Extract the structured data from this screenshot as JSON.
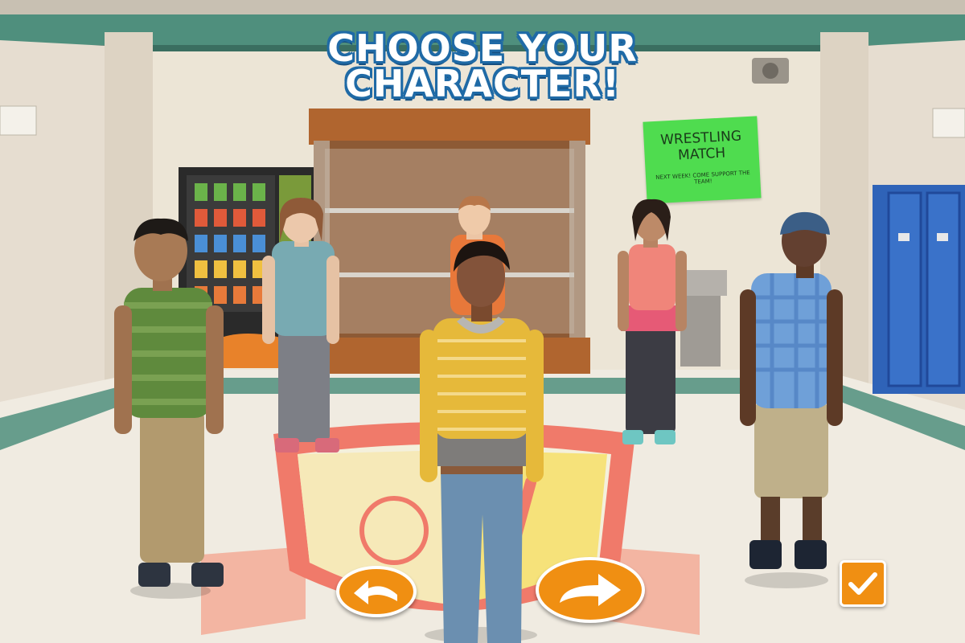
{
  "title": {
    "line1": "CHOOSE YOUR",
    "line2": "CHARACTER!"
  },
  "poster": {
    "line1": "WRESTLING",
    "line2": "MATCH",
    "footer": "NEXT WEEK! COME SUPPORT THE TEAM!"
  },
  "characters": [
    {
      "id": "boy-green-stripes",
      "shirt": "#5f8a3d",
      "pants": "#a08a62"
    },
    {
      "id": "girl-teal-top",
      "shirt": "#78aab2",
      "pants": "#8a8a8a"
    },
    {
      "id": "boy-orange-shirt",
      "shirt": "#e8783a",
      "pants": "#6b4a2a"
    },
    {
      "id": "girl-yellow-stripes",
      "shirt": "#e6b93a",
      "pants": "#6b8fb0",
      "selected": true
    },
    {
      "id": "girl-coral-top",
      "shirt": "#f0857a",
      "pants": "#3c3c44"
    },
    {
      "id": "boy-blue-plaid",
      "shirt": "#6fa0d8",
      "pants": "#bfb08a"
    }
  ],
  "controls": {
    "previous": "arrow-left-icon",
    "next": "arrow-right-icon",
    "confirm": "checkmark-icon"
  },
  "colors": {
    "button_orange": "#f08f12",
    "title_outline": "#1f6aa6",
    "trim_teal": "#4c8f7e",
    "poster_green": "#4fdc4f",
    "locker_blue": "#2f63b8"
  }
}
